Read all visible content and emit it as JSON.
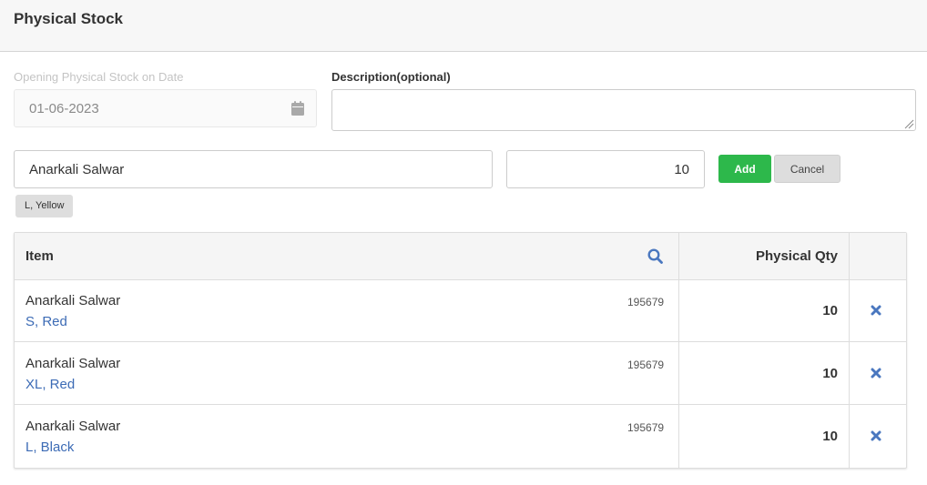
{
  "header": {
    "title": "Physical Stock"
  },
  "form": {
    "date_label": "Opening Physical Stock on Date",
    "date_value": "01-06-2023",
    "description_label": "Description(optional)",
    "description_value": ""
  },
  "entry": {
    "item_value": "Anarkali Salwar",
    "qty_value": "10",
    "add_label": "Add",
    "cancel_label": "Cancel",
    "variant_tag": "L, Yellow"
  },
  "table": {
    "columns": {
      "item": "Item",
      "physical_qty": "Physical Qty"
    },
    "rows": [
      {
        "name": "Anarkali Salwar",
        "variant": "S, Red",
        "code": "195679",
        "qty": "10"
      },
      {
        "name": "Anarkali Salwar",
        "variant": "XL, Red",
        "code": "195679",
        "qty": "10"
      },
      {
        "name": "Anarkali Salwar",
        "variant": "L, Black",
        "code": "195679",
        "qty": "10"
      }
    ]
  },
  "icons": {
    "calendar": "calendar-icon",
    "search": "search-icon",
    "remove": "close-icon"
  },
  "colors": {
    "accent_green": "#2db84b",
    "link_blue": "#3c6bb5",
    "icon_blue": "#4a77bf"
  }
}
